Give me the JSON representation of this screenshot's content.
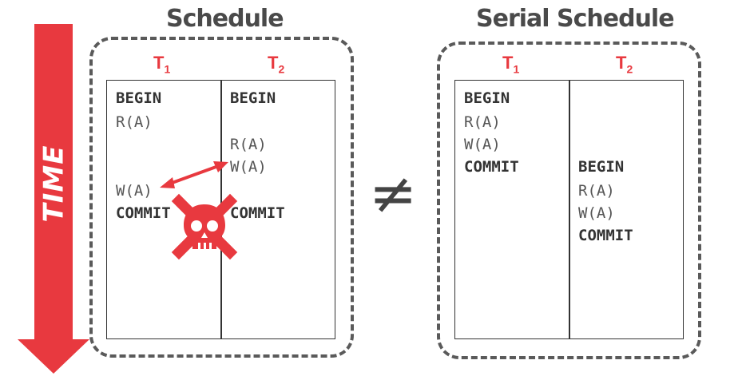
{
  "time_label": "TIME",
  "neq_symbol": "≠",
  "schedule": {
    "title": "Schedule",
    "t1_main": "T",
    "t1_sub": "1",
    "t2_main": "T",
    "t2_sub": "2",
    "t1_ops": [
      "BEGIN",
      "R(A)",
      "W(A)",
      "COMMIT"
    ],
    "t2_ops": [
      "BEGIN",
      "R(A)",
      "W(A)",
      "COMMIT"
    ]
  },
  "serial": {
    "title": "Serial Schedule",
    "t1_main": "T",
    "t1_sub": "1",
    "t2_main": "T",
    "t2_sub": "2",
    "t1_ops": [
      "BEGIN",
      "R(A)",
      "W(A)",
      "COMMIT"
    ],
    "t2_ops": [
      "BEGIN",
      "R(A)",
      "W(A)",
      "COMMIT"
    ]
  },
  "colors": {
    "accent_red": "#e8393f",
    "dark_gray": "#4a4a4a"
  },
  "icons": {
    "conflict": "skull-crossbones-icon",
    "arrow": "double-arrow-icon"
  }
}
